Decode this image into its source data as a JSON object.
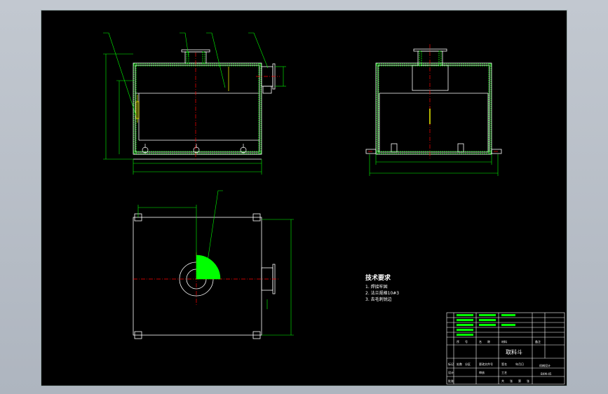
{
  "colors": {
    "background": "#000000",
    "outline": "#ffffff",
    "hidden": "#ffff00",
    "centerline": "#ff0000",
    "dimension": "#00ff00",
    "hatch": "#00ff00",
    "viewport": "#b9c0c9"
  },
  "technical_notes": {
    "title": "技术要求",
    "items": [
      "1. 焊接牢固",
      "2. 法兰规格10#3",
      "3. 去毛刺锐边"
    ]
  },
  "title_block": {
    "part_name": "取料斗",
    "drawing_number": "BXM-45",
    "company": "机械设计",
    "label_row": [
      "序",
      "号",
      "名",
      "称",
      "材料",
      "备注"
    ],
    "approval": [
      "标记",
      "处数",
      "分区",
      "更改文件号",
      "签名",
      "年月日"
    ],
    "signoff": [
      "设计",
      "审核",
      "工艺",
      "批准"
    ],
    "footer": [
      "共",
      "张",
      "第",
      "张"
    ]
  }
}
